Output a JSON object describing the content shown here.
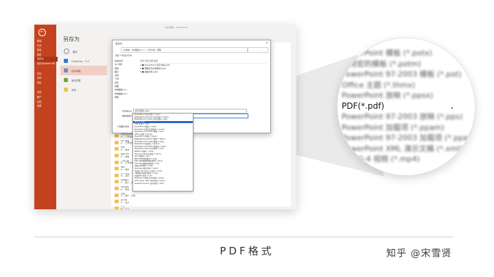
{
  "window": {
    "title": "演示文稿1 - PowerPoint"
  },
  "sidebar": {
    "items": [
      {
        "label": "新建"
      },
      {
        "label": "打开"
      },
      {
        "label": "信息"
      },
      {
        "label": "保存"
      },
      {
        "label": "另存为",
        "active": true
      },
      {
        "label": "另存为Adobe PDF"
      },
      {
        "label": "打印"
      },
      {
        "label": "共享"
      },
      {
        "label": "导出"
      },
      {
        "label": "关闭"
      },
      {
        "label": "帐户"
      },
      {
        "label": "反馈"
      },
      {
        "label": "选项"
      }
    ]
  },
  "page_title": "另存为",
  "locations": [
    {
      "label": "最近",
      "icon": "clock-icon",
      "color": "#8a8a8a"
    },
    {
      "label": "OneDrive - 个人",
      "icon": "cloud-icon",
      "color": "#2b7cd3"
    },
    {
      "label": "这台电脑",
      "icon": "pc-icon",
      "color": "#6f8fb5",
      "selected": true
    },
    {
      "label": "添加位置",
      "icon": "globe-icon",
      "color": "#6aa84f"
    },
    {
      "label": "浏览",
      "icon": "folder-icon",
      "color": "#f2c14e"
    }
  ],
  "dialog": {
    "title": "另存为",
    "address": "此电脑 › 本地磁盘 (D:) › 工作文档 › 课程",
    "toolbar": "组织 ▾    新建文件夹",
    "tree": [
      "快速访问",
      "3D 对象",
      "视频",
      "图片",
      "文档",
      "下载",
      "音乐",
      "桌面",
      "本地磁盘 (C:)",
      "本地磁盘 (D:)",
      "网络"
    ],
    "file_headers": "名称                               修改日期              类型",
    "files": [
      "1 ■ PowerPoint 演示文稿.pptx",
      "2 ■ 课程演示文稿素材.pptx",
      "3 ■ 模板文件.pptx"
    ],
    "filename_label": "文件名(N):",
    "filename_value": "演示文稿1.pptx",
    "filetype_label": "保存类型(T):",
    "filetype_value": "PowerPoint 演示文稿 (*.pptx)",
    "hide_folders": "∧ 隐藏文件夹"
  },
  "dropdown_items": [
    "PowerPoint 演示文稿 (*.pptx)",
    "启用宏的 PowerPoint 演示文稿 (*.pptm)",
    "PowerPoint 97-2003 演示文稿 (*.ppt)",
    "PDF (*.pdf)",
    "XPS 文档 (*.xps)",
    "PowerPoint 模板 (*.potx)",
    "PowerPoint 启用宏的模板 (*.potm)",
    "PowerPoint 97-2003 模板 (*.pot)",
    "Office 主题 (*.thmx)",
    "PowerPoint 放映 (*.ppsx)",
    "启用宏的 PowerPoint 放映 (*.ppsm)",
    "PowerPoint 97-2003 放映 (*.pps)",
    "PowerPoint 加载项 (*.ppam)",
    "PowerPoint 97-2003 加载项 (*.ppa)",
    "PowerPoint XML 演示文稿 (*.xml)",
    "MPEG-4 视频 (*.mp4)",
    "Windows Media 视频 (*.wmv)",
    "GIF 动态图 (*.gif)",
    "JPEG 文件交换格式 (*.jpg)",
    "PNG 可移植网络图形格式 (*.png)",
    "TIFF Tag 图像文件格式 (*.tif)",
    "设备无关位图 (*.bmp)",
    "Windows 图元文件 (*.wmf)",
    "增强型 Windows 元文件 (*.emf)",
    "可缩放矢量图形格式 (*.svg)",
    "大纲/RTF 文件 (*.rtf)",
    "PowerPoint 图片演示文稿 (*.pptx)",
    "Strict Open XML 演示文稿 (*.pptx)",
    "OpenDocument 演示文稿 (*.odp)"
  ],
  "dropdown_highlight_index": 3,
  "recent_folders": [
    {
      "name": "我的作品文件夹",
      "path": "D: › 工作文档 › 作品"
    },
    {
      "name": "PPT 课程",
      "path": "D: › 工作文档 › 课程"
    },
    {
      "name": "素材",
      "path": "D: › 素材"
    },
    {
      "name": "模板 PPT",
      "path": "D: › 模板"
    },
    {
      "name": "工作汇报",
      "path": "D: › 工作文档"
    },
    {
      "name": "课件",
      "path": "D: › 课件"
    },
    {
      "name": "10 个演示",
      "path": "D: › 演示"
    },
    {
      "name": "我的图片",
      "path": "C: › 用户 › 图片"
    },
    {
      "name": "项目资料",
      "path": "D: › 项目"
    },
    {
      "name": "文档",
      "path": "C: › 用户 › 文档"
    },
    {
      "name": "设计稿",
      "path": "D: › 设计"
    },
    {
      "name": "个人",
      "path": "D: › 个人"
    },
    {
      "name": "PPT 培训资料",
      "path": "D: › 培训"
    },
    {
      "name": "归档",
      "path": "D: › 归档"
    }
  ],
  "magnifier": {
    "items": [
      "PowerPoint 模板 (*.potx)",
      "启用宏的模板 (*.potm)",
      "PowerPoint 97-2003 模板 (*.pot)",
      "Office 主题 (*.thmx)",
      "PowerPoint 放映 (*.ppsx)",
      "PDF(*.pdf)",
      "PowerPoint 97-2003 放映 (*.pps)",
      "PowerPoint 加载项 (*.ppam)",
      "PowerPoint 97-2003 加载项 (*.ppa)",
      "PowerPoint XML 演示文稿 (*.xml)",
      "MPEG-4 视频 (*.mp4)"
    ],
    "focus_index": 5
  },
  "caption": "PDF格式",
  "watermark": "知乎 @宋雪贤",
  "colors": {
    "accent": "#c4431f",
    "highlight": "#2b63c6"
  }
}
